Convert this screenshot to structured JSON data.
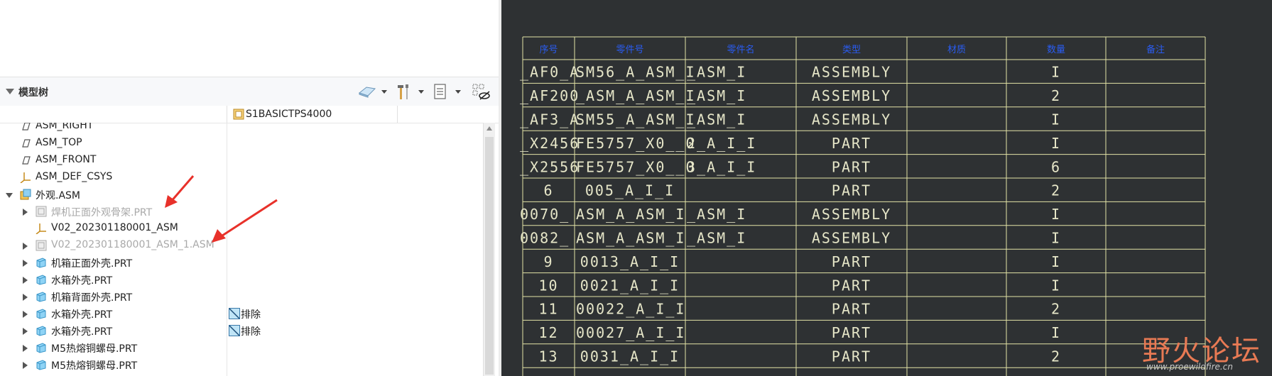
{
  "panel": {
    "title": "模型树",
    "column_header": "S1BASICTPS4000"
  },
  "tree": [
    {
      "label": "ASM_RIGHT",
      "icon": "datum-plane-icon",
      "indent": 1,
      "expand": "none",
      "dim": false
    },
    {
      "label": "ASM_TOP",
      "icon": "datum-plane-icon",
      "indent": 1,
      "expand": "none",
      "dim": false
    },
    {
      "label": "ASM_FRONT",
      "icon": "datum-plane-icon",
      "indent": 1,
      "expand": "none",
      "dim": false
    },
    {
      "label": "ASM_DEF_CSYS",
      "icon": "coordinate-system-icon",
      "indent": 1,
      "expand": "none",
      "dim": false
    },
    {
      "label": "外观.ASM",
      "icon": "assembly-icon",
      "indent": 1,
      "expand": "open",
      "dim": false
    },
    {
      "label": "焊机正面外观骨架.PRT",
      "icon": "skeleton-part-icon",
      "indent": 2,
      "expand": "closed",
      "dim": true
    },
    {
      "label": "V02_202301180001_ASM",
      "icon": "coordinate-system-icon",
      "indent": 2,
      "expand": "none",
      "dim": false
    },
    {
      "label": "V02_202301180001_ASM_1.ASM",
      "icon": "skeleton-part-icon",
      "indent": 2,
      "expand": "closed",
      "dim": true
    },
    {
      "label": "机箱正面外壳.PRT",
      "icon": "part-icon",
      "indent": 2,
      "expand": "closed",
      "dim": false
    },
    {
      "label": "水箱外壳.PRT",
      "icon": "part-icon",
      "indent": 2,
      "expand": "closed",
      "dim": false
    },
    {
      "label": "机箱背面外壳.PRT",
      "icon": "part-icon",
      "indent": 2,
      "expand": "closed",
      "dim": false
    },
    {
      "label": "水箱外壳.PRT",
      "icon": "part-icon",
      "indent": 2,
      "expand": "closed",
      "dim": false,
      "column": "排除"
    },
    {
      "label": "水箱外壳.PRT",
      "icon": "part-icon",
      "indent": 2,
      "expand": "closed",
      "dim": false,
      "column": "排除"
    },
    {
      "label": "M5热熔铜螺母.PRT",
      "icon": "part-icon",
      "indent": 2,
      "expand": "closed",
      "dim": false
    },
    {
      "label": "M5热熔铜螺母.PRT",
      "icon": "part-icon",
      "indent": 2,
      "expand": "closed",
      "dim": false
    },
    {
      "label": "M5热熔铜螺母.PRT",
      "icon": "part-icon",
      "indent": 2,
      "expand": "closed",
      "dim": false
    }
  ],
  "bom": {
    "headers": [
      "序号",
      "零件号",
      "零件名",
      "类型",
      "材质",
      "数量",
      "备注"
    ],
    "rows": [
      [
        "_AF0_A",
        "SM56_A_ASM_I",
        "_ASM_I",
        "ASSEMBLY",
        "",
        "I",
        ""
      ],
      [
        "_AF200",
        "_ASM_A_ASM_I",
        "_ASM_I",
        "ASSEMBLY",
        "",
        "2",
        ""
      ],
      [
        "_AF3_A",
        "SM55_A_ASM_I",
        "_ASM_I",
        "ASSEMBLY",
        "",
        "I",
        ""
      ],
      [
        "_X2456",
        "FE5757_X0__0",
        "2_A_I_I",
        "PART",
        "",
        "I",
        ""
      ],
      [
        "_X2556",
        "FE5757_X0__0",
        "3_A_I_I",
        "PART",
        "",
        "6",
        ""
      ],
      [
        "6",
        "005_A_I_I",
        "",
        "PART",
        "",
        "2",
        ""
      ],
      [
        "0070_",
        "ASM_A_ASM_I",
        "_ASM_I",
        "ASSEMBLY",
        "",
        "I",
        ""
      ],
      [
        "0082_",
        "ASM_A_ASM_I",
        "_ASM_I",
        "ASSEMBLY",
        "",
        "I",
        ""
      ],
      [
        "9",
        "0013_A_I_I",
        "",
        "PART",
        "",
        "I",
        ""
      ],
      [
        "10",
        "0021_A_I_I",
        "",
        "PART",
        "",
        "I",
        ""
      ],
      [
        "11",
        "00022_A_I_I",
        "",
        "PART",
        "",
        "2",
        ""
      ],
      [
        "12",
        "00027_A_I_I",
        "",
        "PART",
        "",
        "I",
        ""
      ],
      [
        "13",
        "0031_A_I_I",
        "",
        "PART",
        "",
        "2",
        ""
      ]
    ]
  },
  "watermark": {
    "text": "野火论坛",
    "url": "www.proewildfire.cn"
  },
  "colors": {
    "bg_drawing": "#2e3133",
    "grid_line": "#e3e3a6",
    "header_text": "#2a5cf0",
    "cell_text": "#e6e6c8",
    "annotation_arrow": "#e8312a"
  }
}
